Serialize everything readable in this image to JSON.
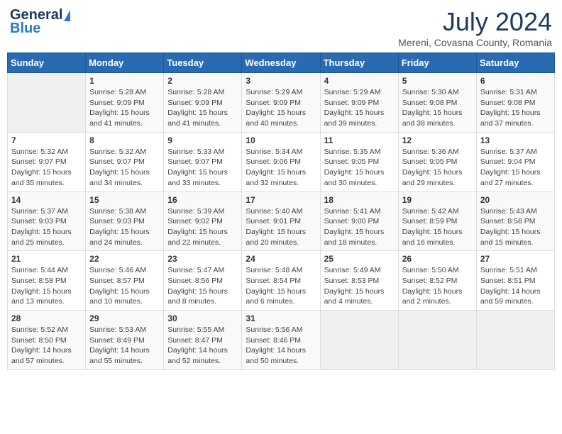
{
  "header": {
    "logo_general": "General",
    "logo_blue": "Blue",
    "month_title": "July 2024",
    "location": "Mereni, Covasna County, Romania"
  },
  "weekdays": [
    "Sunday",
    "Monday",
    "Tuesday",
    "Wednesday",
    "Thursday",
    "Friday",
    "Saturday"
  ],
  "weeks": [
    [
      {
        "day": "",
        "info": ""
      },
      {
        "day": "1",
        "info": "Sunrise: 5:28 AM\nSunset: 9:09 PM\nDaylight: 15 hours\nand 41 minutes."
      },
      {
        "day": "2",
        "info": "Sunrise: 5:28 AM\nSunset: 9:09 PM\nDaylight: 15 hours\nand 41 minutes."
      },
      {
        "day": "3",
        "info": "Sunrise: 5:29 AM\nSunset: 9:09 PM\nDaylight: 15 hours\nand 40 minutes."
      },
      {
        "day": "4",
        "info": "Sunrise: 5:29 AM\nSunset: 9:09 PM\nDaylight: 15 hours\nand 39 minutes."
      },
      {
        "day": "5",
        "info": "Sunrise: 5:30 AM\nSunset: 9:08 PM\nDaylight: 15 hours\nand 38 minutes."
      },
      {
        "day": "6",
        "info": "Sunrise: 5:31 AM\nSunset: 9:08 PM\nDaylight: 15 hours\nand 37 minutes."
      }
    ],
    [
      {
        "day": "7",
        "info": "Sunrise: 5:32 AM\nSunset: 9:07 PM\nDaylight: 15 hours\nand 35 minutes."
      },
      {
        "day": "8",
        "info": "Sunrise: 5:32 AM\nSunset: 9:07 PM\nDaylight: 15 hours\nand 34 minutes."
      },
      {
        "day": "9",
        "info": "Sunrise: 5:33 AM\nSunset: 9:07 PM\nDaylight: 15 hours\nand 33 minutes."
      },
      {
        "day": "10",
        "info": "Sunrise: 5:34 AM\nSunset: 9:06 PM\nDaylight: 15 hours\nand 32 minutes."
      },
      {
        "day": "11",
        "info": "Sunrise: 5:35 AM\nSunset: 9:05 PM\nDaylight: 15 hours\nand 30 minutes."
      },
      {
        "day": "12",
        "info": "Sunrise: 5:36 AM\nSunset: 9:05 PM\nDaylight: 15 hours\nand 29 minutes."
      },
      {
        "day": "13",
        "info": "Sunrise: 5:37 AM\nSunset: 9:04 PM\nDaylight: 15 hours\nand 27 minutes."
      }
    ],
    [
      {
        "day": "14",
        "info": "Sunrise: 5:37 AM\nSunset: 9:03 PM\nDaylight: 15 hours\nand 25 minutes."
      },
      {
        "day": "15",
        "info": "Sunrise: 5:38 AM\nSunset: 9:03 PM\nDaylight: 15 hours\nand 24 minutes."
      },
      {
        "day": "16",
        "info": "Sunrise: 5:39 AM\nSunset: 9:02 PM\nDaylight: 15 hours\nand 22 minutes."
      },
      {
        "day": "17",
        "info": "Sunrise: 5:40 AM\nSunset: 9:01 PM\nDaylight: 15 hours\nand 20 minutes."
      },
      {
        "day": "18",
        "info": "Sunrise: 5:41 AM\nSunset: 9:00 PM\nDaylight: 15 hours\nand 18 minutes."
      },
      {
        "day": "19",
        "info": "Sunrise: 5:42 AM\nSunset: 8:59 PM\nDaylight: 15 hours\nand 16 minutes."
      },
      {
        "day": "20",
        "info": "Sunrise: 5:43 AM\nSunset: 8:58 PM\nDaylight: 15 hours\nand 15 minutes."
      }
    ],
    [
      {
        "day": "21",
        "info": "Sunrise: 5:44 AM\nSunset: 8:58 PM\nDaylight: 15 hours\nand 13 minutes."
      },
      {
        "day": "22",
        "info": "Sunrise: 5:46 AM\nSunset: 8:57 PM\nDaylight: 15 hours\nand 10 minutes."
      },
      {
        "day": "23",
        "info": "Sunrise: 5:47 AM\nSunset: 8:56 PM\nDaylight: 15 hours\nand 8 minutes."
      },
      {
        "day": "24",
        "info": "Sunrise: 5:48 AM\nSunset: 8:54 PM\nDaylight: 15 hours\nand 6 minutes."
      },
      {
        "day": "25",
        "info": "Sunrise: 5:49 AM\nSunset: 8:53 PM\nDaylight: 15 hours\nand 4 minutes."
      },
      {
        "day": "26",
        "info": "Sunrise: 5:50 AM\nSunset: 8:52 PM\nDaylight: 15 hours\nand 2 minutes."
      },
      {
        "day": "27",
        "info": "Sunrise: 5:51 AM\nSunset: 8:51 PM\nDaylight: 14 hours\nand 59 minutes."
      }
    ],
    [
      {
        "day": "28",
        "info": "Sunrise: 5:52 AM\nSunset: 8:50 PM\nDaylight: 14 hours\nand 57 minutes."
      },
      {
        "day": "29",
        "info": "Sunrise: 5:53 AM\nSunset: 8:49 PM\nDaylight: 14 hours\nand 55 minutes."
      },
      {
        "day": "30",
        "info": "Sunrise: 5:55 AM\nSunset: 8:47 PM\nDaylight: 14 hours\nand 52 minutes."
      },
      {
        "day": "31",
        "info": "Sunrise: 5:56 AM\nSunset: 8:46 PM\nDaylight: 14 hours\nand 50 minutes."
      },
      {
        "day": "",
        "info": ""
      },
      {
        "day": "",
        "info": ""
      },
      {
        "day": "",
        "info": ""
      }
    ]
  ]
}
